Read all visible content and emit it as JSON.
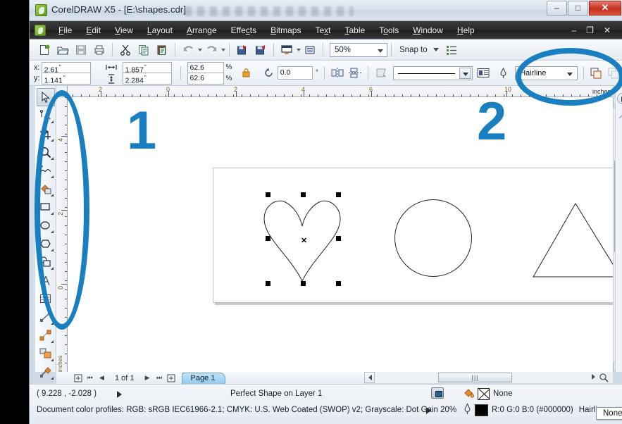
{
  "window": {
    "title": "CorelDRAW X5 - [E:\\shapes.cdr]",
    "app_icon": "coreldraw-icon",
    "minimize": "–",
    "maximize": "□",
    "close": "✕"
  },
  "menubar": {
    "items": [
      {
        "label": "File",
        "mnemonic": "F"
      },
      {
        "label": "Edit",
        "mnemonic": "E"
      },
      {
        "label": "View",
        "mnemonic": "V"
      },
      {
        "label": "Layout",
        "mnemonic": "L"
      },
      {
        "label": "Arrange",
        "mnemonic": "A"
      },
      {
        "label": "Effects",
        "mnemonic": "c"
      },
      {
        "label": "Bitmaps",
        "mnemonic": "B"
      },
      {
        "label": "Text",
        "mnemonic": "x"
      },
      {
        "label": "Table",
        "mnemonic": "T"
      },
      {
        "label": "Tools",
        "mnemonic": "o"
      },
      {
        "label": "Window",
        "mnemonic": "W"
      },
      {
        "label": "Help",
        "mnemonic": "H"
      }
    ],
    "doc_minimize": "–",
    "doc_restore": "❐",
    "doc_close": "✕"
  },
  "toolbar": {
    "buttons": [
      {
        "name": "new-document",
        "glyph": "new-icon"
      },
      {
        "name": "open-document",
        "glyph": "folder-open-icon"
      },
      {
        "name": "save-document",
        "glyph": "save-icon"
      },
      {
        "name": "print-document",
        "glyph": "print-icon"
      },
      {
        "name": "cut",
        "glyph": "scissors-icon"
      },
      {
        "name": "copy",
        "glyph": "copy-icon"
      },
      {
        "name": "paste",
        "glyph": "paste-icon"
      },
      {
        "name": "undo",
        "glyph": "undo-icon"
      },
      {
        "name": "redo",
        "glyph": "redo-icon"
      },
      {
        "name": "import",
        "glyph": "import-icon"
      },
      {
        "name": "export",
        "glyph": "export-icon"
      },
      {
        "name": "application-launcher",
        "glyph": "launcher-icon"
      },
      {
        "name": "options",
        "glyph": "options-icon"
      }
    ],
    "zoom_level": "50%",
    "snap_to_label": "Snap to",
    "options_icon": "options-list-icon"
  },
  "propertybar": {
    "x_label": "x:",
    "y_label": "y:",
    "x_value": "2.61",
    "y_value": "1.141",
    "unit": "\"",
    "width_value": "1.857",
    "height_value": "2.284",
    "width_icon": "width-arrows-icon",
    "height_icon": "height-arrows-icon",
    "scale_h": "62.6",
    "scale_v": "62.6",
    "percent": "%",
    "lock_icon": "lock-ratio-icon",
    "rotation_icon": "rotate-icon",
    "rotation_value": "0.0",
    "degree": "°",
    "mirror_h_icon": "mirror-horizontal-icon",
    "mirror_v_icon": "mirror-vertical-icon",
    "shape_icon": "shape-properties-icon",
    "outline_width_icon": "outline-pen-icon",
    "outline_width_value": "Hairline",
    "wrap_icon": "text-wrap-icon",
    "page_icon": "to-front-icon"
  },
  "toolbox": {
    "tools": [
      {
        "name": "pick-tool",
        "selected": true
      },
      {
        "name": "shape-tool",
        "selected": false
      },
      {
        "name": "crop-tool",
        "selected": false
      },
      {
        "name": "zoom-tool",
        "selected": false
      },
      {
        "name": "freehand-tool",
        "selected": false
      },
      {
        "name": "smart-fill-tool",
        "selected": false
      },
      {
        "name": "rectangle-tool",
        "selected": false
      },
      {
        "name": "ellipse-tool",
        "selected": false
      },
      {
        "name": "polygon-tool",
        "selected": false
      },
      {
        "name": "basic-shapes-tool",
        "selected": false
      },
      {
        "name": "text-tool",
        "selected": false
      },
      {
        "name": "table-tool",
        "selected": false
      },
      {
        "name": "dimension-tool",
        "selected": false
      },
      {
        "name": "connector-tool",
        "selected": false
      },
      {
        "name": "blend-tool",
        "selected": false
      },
      {
        "name": "color-eyedropper-tool",
        "selected": false
      }
    ]
  },
  "rulers": {
    "unit": "inches",
    "horizontal_labels": [
      "2",
      "0",
      "2",
      "4",
      "6",
      "10"
    ],
    "vertical_labels": [
      "4",
      "2",
      "0"
    ]
  },
  "canvas": {
    "shapes": [
      {
        "name": "heart-shape",
        "selected": true
      },
      {
        "name": "circle-shape",
        "selected": false
      },
      {
        "name": "triangle-shape",
        "selected": false
      }
    ],
    "selection_center_marker": "✕"
  },
  "palette": {
    "none_swatch": "none-color-swatch",
    "colors": [
      "#0a0a0a",
      "#1e1e1e",
      "#3c3c3c",
      "#555555",
      "#6b6b6b",
      "#868686",
      "#9e9e9e",
      "#b5b5b5",
      "#cfcfcf",
      "#e8e8e8",
      "#ffffff",
      "#3b5ba8",
      "#64c8e0",
      "#6cb551",
      "#f2e216",
      "#ee2222",
      "#c452b0",
      "#8e54ab"
    ],
    "scroll_up_icon": "palette-scroll-up-icon",
    "scroll_down_icon": "palette-scroll-down-icon",
    "expand_icon": "palette-expand-icon"
  },
  "pagenav": {
    "add_page_start_icon": "add-page-icon",
    "first_icon": "⏮",
    "prev_icon": "◀",
    "counter": "1 of 1",
    "next_icon": "▶",
    "last_icon": "⏭",
    "add_page_end_icon": "add-page-icon",
    "page_tab": "Page 1"
  },
  "statusbar": {
    "coordinates": "( 9.228 , -2.028 )",
    "object_info": "Perfect Shape on Layer 1",
    "color_profiles": "Document color profiles: RGB: sRGB IEC61966-2.1; CMYK: U.S. Web Coated (SWOP) v2; Grayscale: Dot Gain 20%",
    "fill_icon": "fill-bucket-icon",
    "fill_value": "None",
    "outline_icon": "outline-pen-icon",
    "outline_color": "R:0 G:0 B:0 (#000000)",
    "outline_width": "Hairline",
    "tooltip": "None",
    "snapshot_icon": "snapshot-icon"
  },
  "annotations": {
    "marker_1": "1",
    "marker_2": "2",
    "color": "#1a7fc1",
    "ellipse_1_target": "toolbox",
    "ellipse_2_target": "outline-width-combo"
  }
}
